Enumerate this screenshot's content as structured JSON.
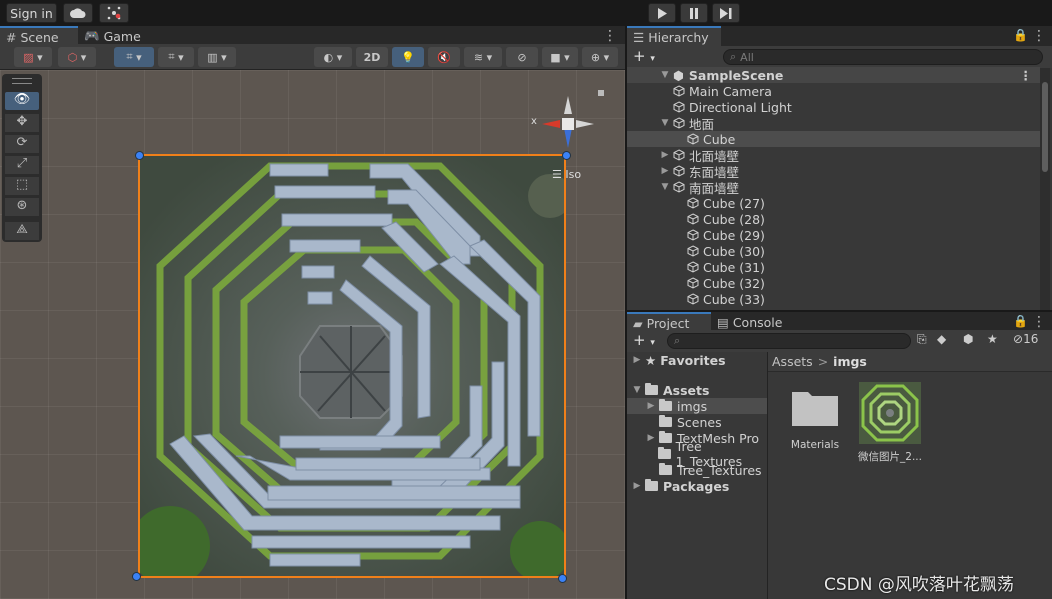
{
  "topbar": {
    "sign_in_label": "Sign in"
  },
  "scene_panel": {
    "tabs": [
      {
        "label": "Scene"
      },
      {
        "label": "Game"
      }
    ],
    "toolbar": {
      "mode_2d_label": "2D"
    },
    "gizmo": {
      "x_label": "x",
      "persp_label": "Iso"
    }
  },
  "hierarchy": {
    "tab_label": "Hierarchy",
    "search_placeholder": "All",
    "scene_name": "SampleScene",
    "items": [
      {
        "label": "Main Camera",
        "indent": 1,
        "fold": ""
      },
      {
        "label": "Directional Light",
        "indent": 1,
        "fold": ""
      },
      {
        "label": "地面",
        "indent": 1,
        "fold": "▼"
      },
      {
        "label": "Cube",
        "indent": 2,
        "fold": "",
        "selected": true
      },
      {
        "label": "北面墙壁",
        "indent": 1,
        "fold": "▶"
      },
      {
        "label": "东面墙壁",
        "indent": 1,
        "fold": "▶"
      },
      {
        "label": "南面墙壁",
        "indent": 1,
        "fold": "▼"
      },
      {
        "label": "Cube (27)",
        "indent": 2,
        "fold": ""
      },
      {
        "label": "Cube (28)",
        "indent": 2,
        "fold": ""
      },
      {
        "label": "Cube (29)",
        "indent": 2,
        "fold": ""
      },
      {
        "label": "Cube (30)",
        "indent": 2,
        "fold": ""
      },
      {
        "label": "Cube (31)",
        "indent": 2,
        "fold": ""
      },
      {
        "label": "Cube (32)",
        "indent": 2,
        "fold": ""
      },
      {
        "label": "Cube (33)",
        "indent": 2,
        "fold": ""
      }
    ]
  },
  "project": {
    "tabs": [
      {
        "label": "Project"
      },
      {
        "label": "Console"
      }
    ],
    "hidden_count": "16",
    "favorites_label": "Favorites",
    "assets_label": "Assets",
    "packages_label": "Packages",
    "tree": [
      {
        "label": "imgs",
        "fold": "▶",
        "selected": true
      },
      {
        "label": "Scenes",
        "fold": ""
      },
      {
        "label": "TextMesh Pro",
        "fold": "▶"
      },
      {
        "label": "Tree 1_Textures",
        "fold": ""
      },
      {
        "label": "Tree_Textures",
        "fold": ""
      }
    ],
    "breadcrumb": {
      "root": "Assets",
      "separator": ">",
      "current": "imgs"
    },
    "grid_items": [
      {
        "label": "Materials",
        "type": "folder"
      },
      {
        "label": "微信图片_2...",
        "type": "image"
      }
    ]
  },
  "watermark": "CSDN @风吹落叶花飘荡"
}
